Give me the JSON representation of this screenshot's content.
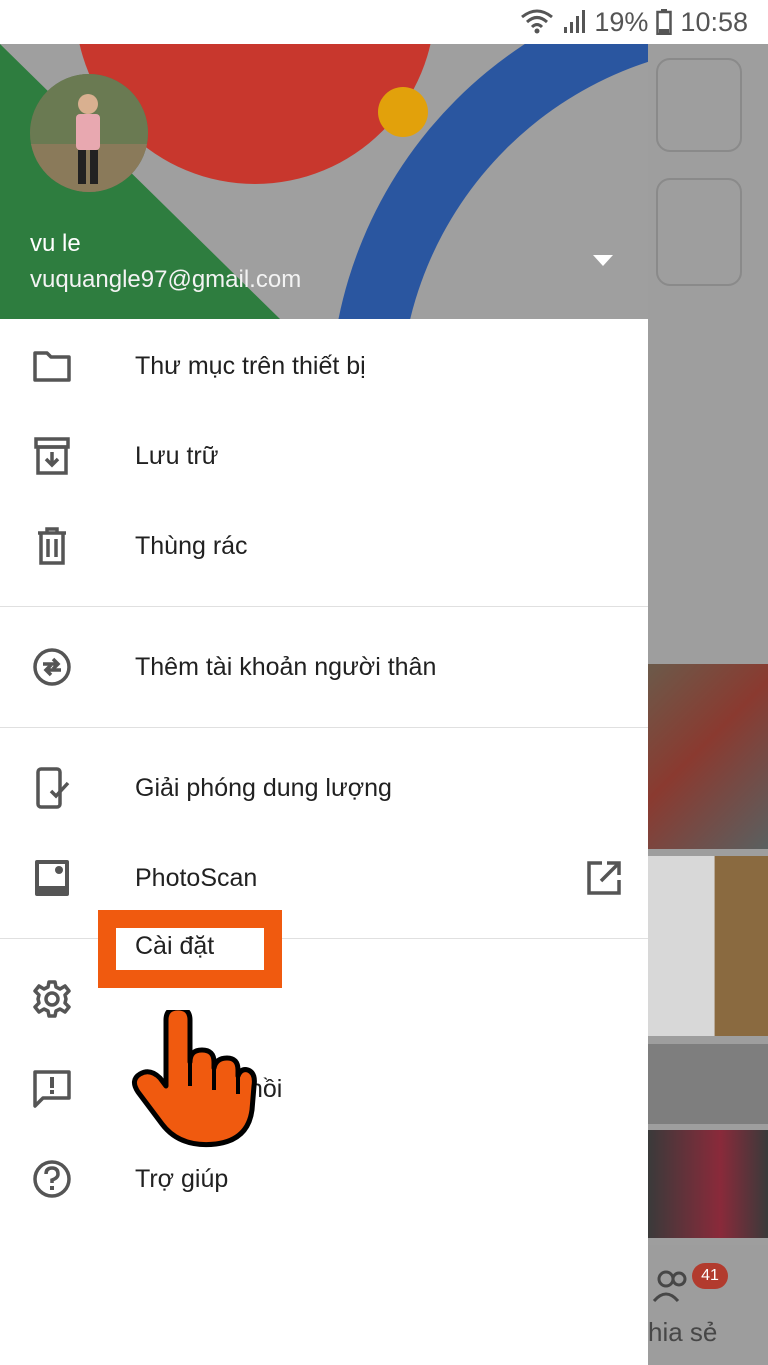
{
  "status": {
    "battery": "19%",
    "time": "10:58"
  },
  "account": {
    "name": "vu le",
    "email": "vuquangle97@gmail.com"
  },
  "menu": {
    "device_folders": "Thư mục trên thiết bị",
    "archive": "Lưu trữ",
    "trash": "Thùng rác",
    "partner_account": "Thêm tài khoản người thân",
    "free_up_space": "Giải phóng dung lượng",
    "photoscan": "PhotoScan",
    "settings": "Cài đặt",
    "feedback": "Gửi phản hồi",
    "feedback_visible": "hồi",
    "help": "Trợ giúp"
  },
  "background": {
    "badge_count": "41",
    "share_label_partial": "hia sẻ"
  },
  "colors": {
    "accent": "#f05a0f",
    "google_red": "#c8372d",
    "google_blue": "#2a56a0",
    "google_green": "#2e7d3f",
    "google_yellow": "#e2a10b"
  }
}
